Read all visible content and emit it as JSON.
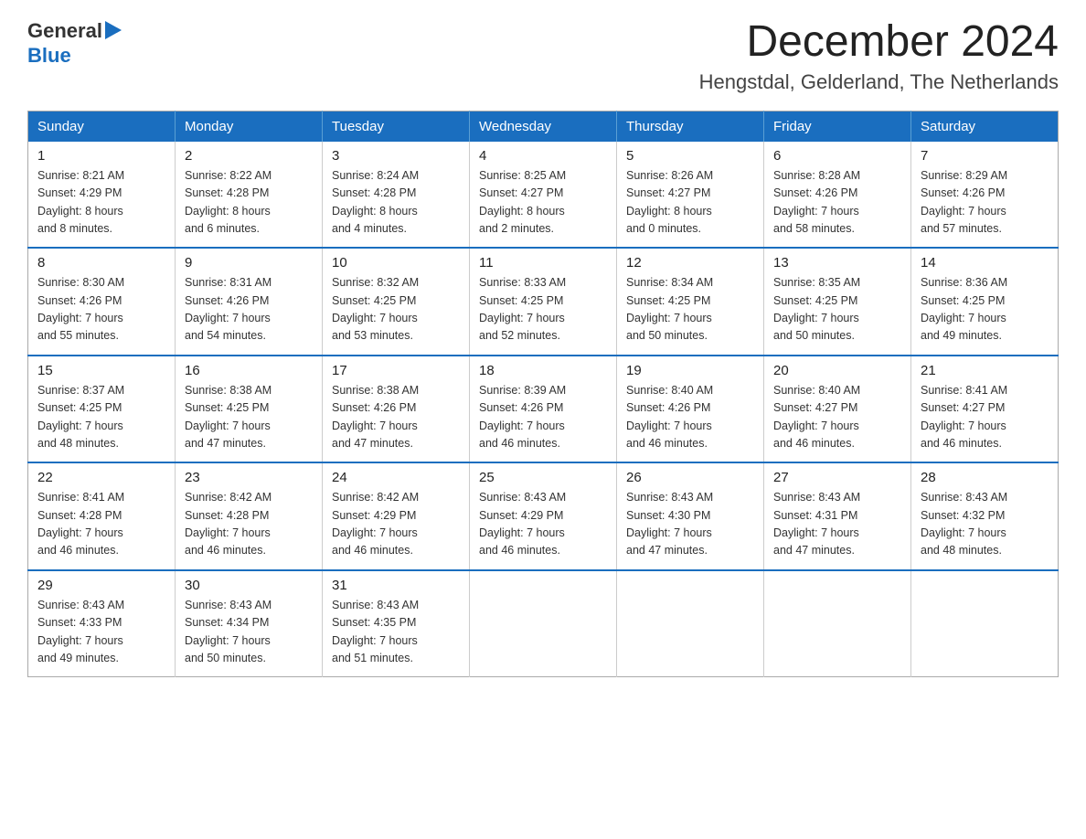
{
  "header": {
    "logo": {
      "general": "General",
      "blue": "Blue"
    },
    "month": "December 2024",
    "location": "Hengstdal, Gelderland, The Netherlands"
  },
  "days_of_week": [
    "Sunday",
    "Monday",
    "Tuesday",
    "Wednesday",
    "Thursday",
    "Friday",
    "Saturday"
  ],
  "weeks": [
    [
      {
        "day": "1",
        "sunrise": "8:21 AM",
        "sunset": "4:29 PM",
        "daylight": "8 hours and 8 minutes."
      },
      {
        "day": "2",
        "sunrise": "8:22 AM",
        "sunset": "4:28 PM",
        "daylight": "8 hours and 6 minutes."
      },
      {
        "day": "3",
        "sunrise": "8:24 AM",
        "sunset": "4:28 PM",
        "daylight": "8 hours and 4 minutes."
      },
      {
        "day": "4",
        "sunrise": "8:25 AM",
        "sunset": "4:27 PM",
        "daylight": "8 hours and 2 minutes."
      },
      {
        "day": "5",
        "sunrise": "8:26 AM",
        "sunset": "4:27 PM",
        "daylight": "8 hours and 0 minutes."
      },
      {
        "day": "6",
        "sunrise": "8:28 AM",
        "sunset": "4:26 PM",
        "daylight": "7 hours and 58 minutes."
      },
      {
        "day": "7",
        "sunrise": "8:29 AM",
        "sunset": "4:26 PM",
        "daylight": "7 hours and 57 minutes."
      }
    ],
    [
      {
        "day": "8",
        "sunrise": "8:30 AM",
        "sunset": "4:26 PM",
        "daylight": "7 hours and 55 minutes."
      },
      {
        "day": "9",
        "sunrise": "8:31 AM",
        "sunset": "4:26 PM",
        "daylight": "7 hours and 54 minutes."
      },
      {
        "day": "10",
        "sunrise": "8:32 AM",
        "sunset": "4:25 PM",
        "daylight": "7 hours and 53 minutes."
      },
      {
        "day": "11",
        "sunrise": "8:33 AM",
        "sunset": "4:25 PM",
        "daylight": "7 hours and 52 minutes."
      },
      {
        "day": "12",
        "sunrise": "8:34 AM",
        "sunset": "4:25 PM",
        "daylight": "7 hours and 50 minutes."
      },
      {
        "day": "13",
        "sunrise": "8:35 AM",
        "sunset": "4:25 PM",
        "daylight": "7 hours and 50 minutes."
      },
      {
        "day": "14",
        "sunrise": "8:36 AM",
        "sunset": "4:25 PM",
        "daylight": "7 hours and 49 minutes."
      }
    ],
    [
      {
        "day": "15",
        "sunrise": "8:37 AM",
        "sunset": "4:25 PM",
        "daylight": "7 hours and 48 minutes."
      },
      {
        "day": "16",
        "sunrise": "8:38 AM",
        "sunset": "4:25 PM",
        "daylight": "7 hours and 47 minutes."
      },
      {
        "day": "17",
        "sunrise": "8:38 AM",
        "sunset": "4:26 PM",
        "daylight": "7 hours and 47 minutes."
      },
      {
        "day": "18",
        "sunrise": "8:39 AM",
        "sunset": "4:26 PM",
        "daylight": "7 hours and 46 minutes."
      },
      {
        "day": "19",
        "sunrise": "8:40 AM",
        "sunset": "4:26 PM",
        "daylight": "7 hours and 46 minutes."
      },
      {
        "day": "20",
        "sunrise": "8:40 AM",
        "sunset": "4:27 PM",
        "daylight": "7 hours and 46 minutes."
      },
      {
        "day": "21",
        "sunrise": "8:41 AM",
        "sunset": "4:27 PM",
        "daylight": "7 hours and 46 minutes."
      }
    ],
    [
      {
        "day": "22",
        "sunrise": "8:41 AM",
        "sunset": "4:28 PM",
        "daylight": "7 hours and 46 minutes."
      },
      {
        "day": "23",
        "sunrise": "8:42 AM",
        "sunset": "4:28 PM",
        "daylight": "7 hours and 46 minutes."
      },
      {
        "day": "24",
        "sunrise": "8:42 AM",
        "sunset": "4:29 PM",
        "daylight": "7 hours and 46 minutes."
      },
      {
        "day": "25",
        "sunrise": "8:43 AM",
        "sunset": "4:29 PM",
        "daylight": "7 hours and 46 minutes."
      },
      {
        "day": "26",
        "sunrise": "8:43 AM",
        "sunset": "4:30 PM",
        "daylight": "7 hours and 47 minutes."
      },
      {
        "day": "27",
        "sunrise": "8:43 AM",
        "sunset": "4:31 PM",
        "daylight": "7 hours and 47 minutes."
      },
      {
        "day": "28",
        "sunrise": "8:43 AM",
        "sunset": "4:32 PM",
        "daylight": "7 hours and 48 minutes."
      }
    ],
    [
      {
        "day": "29",
        "sunrise": "8:43 AM",
        "sunset": "4:33 PM",
        "daylight": "7 hours and 49 minutes."
      },
      {
        "day": "30",
        "sunrise": "8:43 AM",
        "sunset": "4:34 PM",
        "daylight": "7 hours and 50 minutes."
      },
      {
        "day": "31",
        "sunrise": "8:43 AM",
        "sunset": "4:35 PM",
        "daylight": "7 hours and 51 minutes."
      },
      null,
      null,
      null,
      null
    ]
  ],
  "labels": {
    "sunrise": "Sunrise:",
    "sunset": "Sunset:",
    "daylight": "Daylight:"
  }
}
